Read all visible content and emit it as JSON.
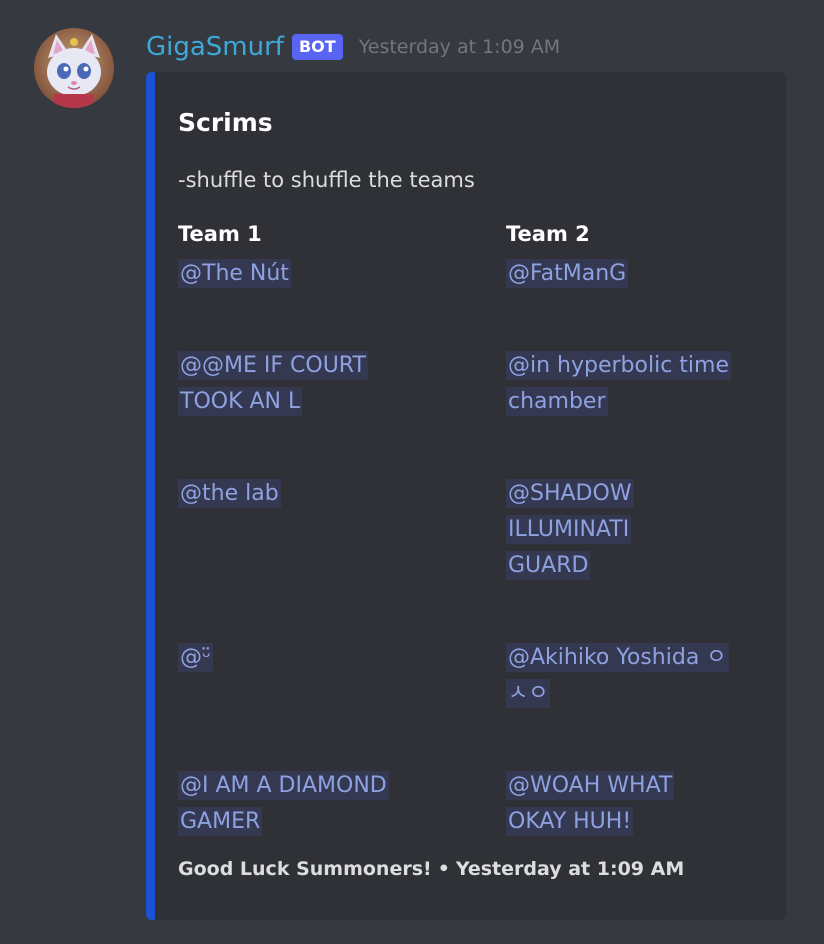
{
  "author": {
    "username": "GigaSmurf",
    "bot_tag": "BOT",
    "timestamp": "Yesterday at 1:09 AM",
    "avatar_icon": "kitten-avatar-icon"
  },
  "embed": {
    "accent_color": "#1a52d6",
    "title": "Scrims",
    "description": "-shuffle to shuffle the teams",
    "fields": [
      {
        "name": "Team 1",
        "members": [
          "@The Nút",
          "@@ME IF COURT TOOK AN L",
          "@the lab",
          "@ᵕ̈",
          "@I AM A DIAMOND GAMER"
        ]
      },
      {
        "name": "Team 2",
        "members": [
          "@FatManG",
          "@in hyperbolic time chamber",
          "@SHADOW ILLUMINATI GUARD",
          "@Akihiko Yoshida ㅇㅅㅇ",
          "@WOAH WHAT OKAY HUH!"
        ]
      }
    ],
    "footer": {
      "text": "Good Luck Summoners!",
      "separator": "•",
      "timestamp": "Yesterday at 1:09 AM"
    }
  },
  "colors": {
    "background": "#36393f",
    "embed_background": "#2f3136",
    "username": "#3ea8d8",
    "mention": "#8ea1e1",
    "bot_tag": "#5865f2"
  }
}
